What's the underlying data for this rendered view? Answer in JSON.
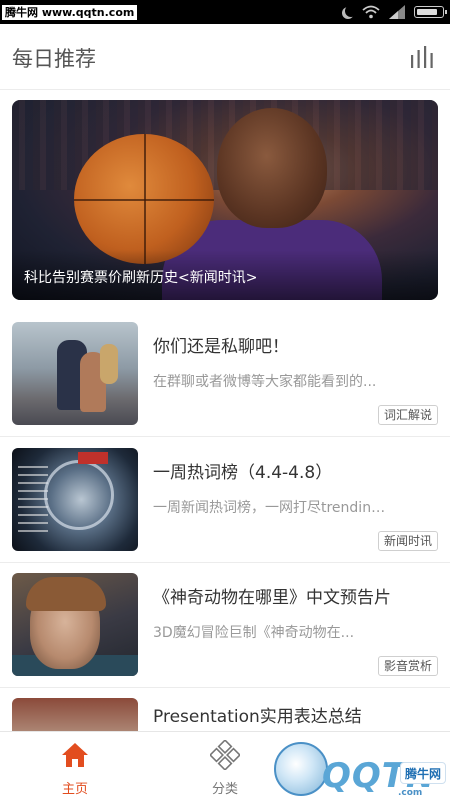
{
  "status_bar": {
    "watermark": "腾牛网 www.qqtn.com",
    "icons": [
      "moon-icon",
      "wifi-icon",
      "signal-icon",
      "battery-icon"
    ]
  },
  "header": {
    "title": "每日推荐",
    "menu_icon": "equalizer-icon"
  },
  "banner": {
    "caption": "科比告别赛票价刷新历史<新闻时讯>"
  },
  "articles": [
    {
      "title": "你们还是私聊吧！",
      "description": "在群聊或者微博等大家都能看到的...",
      "tag": "词汇解说"
    },
    {
      "title": "一周热词榜（4.4-4.8）",
      "description": "一周新闻热词榜，一网打尽trending...",
      "tag": "新闻时讯"
    },
    {
      "title": "《神奇动物在哪里》中文预告片",
      "description": "3D魔幻冒险巨制《神奇动物在...",
      "tag": "影音赏析"
    },
    {
      "title": "Presentation实用表达总结",
      "description": "",
      "tag": ""
    }
  ],
  "bottom_nav": {
    "items": [
      {
        "label": "主页",
        "icon": "home-icon",
        "active": true
      },
      {
        "label": "分类",
        "icon": "category-icon",
        "active": false
      }
    ]
  },
  "corner_watermark": {
    "text": "QQTN",
    "logo": "腾牛网",
    "sub": ".com"
  },
  "colors": {
    "accent": "#e24d1f",
    "divider": "#ececec",
    "muted_text": "#999999"
  }
}
